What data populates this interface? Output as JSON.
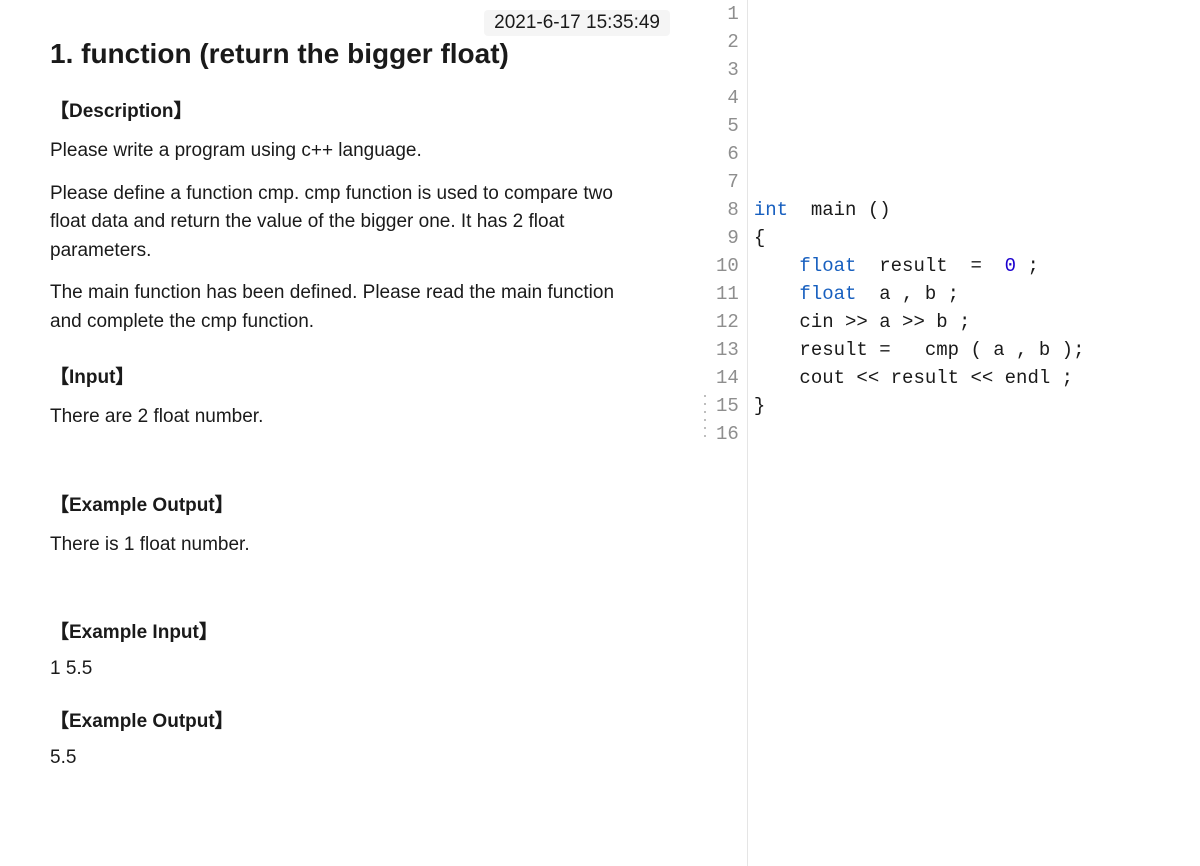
{
  "timestamp": "2021-6-17 15:35:49",
  "title": "1. function (return the bigger float)",
  "sections": {
    "description_header": "【Description】",
    "desc_p1": "Please write a program using c++ language.",
    "desc_p2": "Please define a function cmp. cmp function is used to compare two float data and return the value of the bigger one. It has 2 float parameters.",
    "desc_p3": "The main function has been defined. Please read the main function and complete the cmp function.",
    "input_header": "【Input】",
    "input_p1": "There are 2 float number.",
    "example_output_header": "【Example Output】",
    "example_output_p1": "There is 1 float number.",
    "example_input_header": "【Example Input】",
    "example_input_val": "1 5.5",
    "example_output2_header": "【Example Output】",
    "example_output2_val": "5.5"
  },
  "code": {
    "line_numbers": [
      "1",
      "2",
      "3",
      "4",
      "5",
      "6",
      "7",
      "8",
      "9",
      "10",
      "11",
      "12",
      "13",
      "14",
      "15",
      "16"
    ],
    "l8_a": "int",
    "l8_b": "  main ()",
    "l9": "{",
    "l10_a": "    ",
    "l10_b": "float",
    "l10_c": "  result  =  ",
    "l10_d": "0",
    "l10_e": " ;",
    "l11_a": "    ",
    "l11_b": "float",
    "l11_c": "  a , b ;",
    "l12": "    cin >> a >> b ;",
    "l13": "    result =   cmp ( a , b );",
    "l14": "    cout << result << endl ;",
    "l15": "}"
  }
}
